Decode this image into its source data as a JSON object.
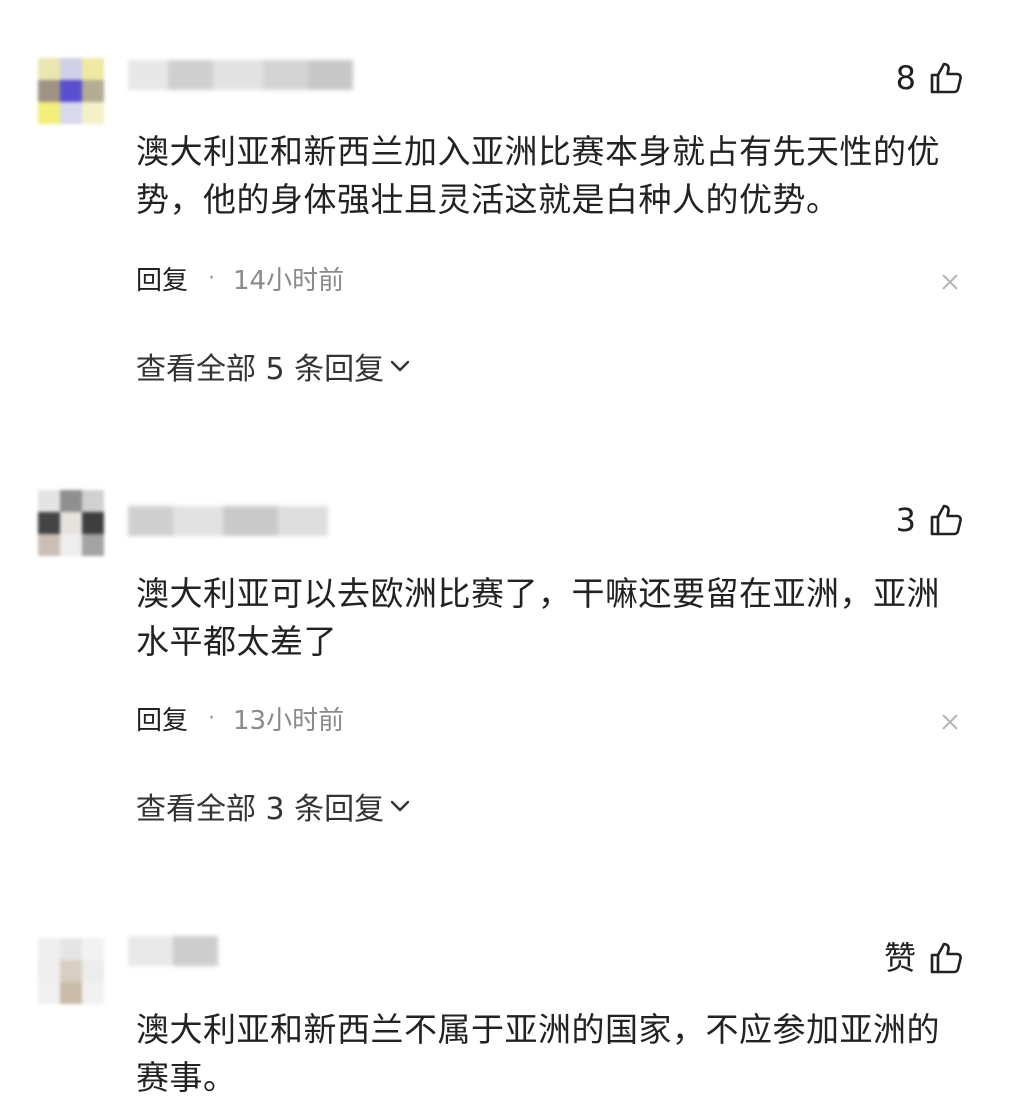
{
  "comments": [
    {
      "likes": "8",
      "text": "澳大利亚和新西兰加入亚洲比赛本身就占有先天性的优势，他的身体强壮且灵活这就是白种人的优势。",
      "reply_label": "回复",
      "separator": "·",
      "time": "14小时前",
      "view_replies": "查看全部 5 条回复"
    },
    {
      "likes": "3",
      "text": "澳大利亚可以去欧洲比赛了，干嘛还要留在亚洲，亚洲水平都太差了",
      "reply_label": "回复",
      "separator": "·",
      "time": "13小时前",
      "view_replies": "查看全部 3 条回复"
    },
    {
      "likes": "赞",
      "text": "澳大利亚和新西兰不属于亚洲的国家，不应参加亚洲的赛事。"
    }
  ],
  "icons": {
    "like": "thumbs-up-icon",
    "close": "close-icon",
    "expand": "chevron-down-icon"
  },
  "colors": {
    "primary_text": "#222222",
    "secondary_text": "#8a8a8a",
    "icon_stroke": "#222222",
    "close_stroke": "#b5b5b5"
  }
}
